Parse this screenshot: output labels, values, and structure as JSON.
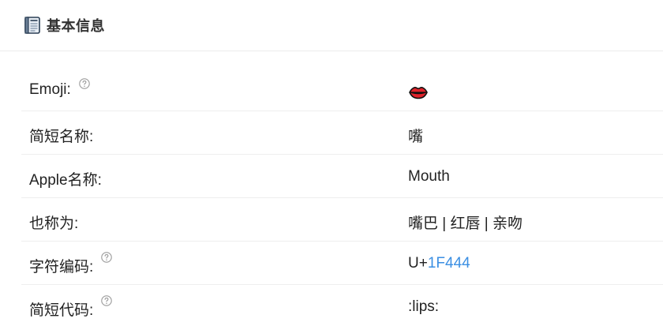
{
  "header": {
    "icon": "newspaper-icon",
    "title": "基本信息"
  },
  "rows": [
    {
      "label": "Emoji:",
      "has_help": true,
      "value_type": "emoji",
      "value_icon": "lips-emoji"
    },
    {
      "label": "简短名称:",
      "has_help": false,
      "value": "嘴"
    },
    {
      "label": "Apple名称:",
      "has_help": false,
      "value": "Mouth"
    },
    {
      "label": "也称为:",
      "has_help": false,
      "value": "嘴巴 | 红唇 | 亲吻"
    },
    {
      "label": "字符编码:",
      "has_help": true,
      "value_prefix": "U+",
      "value_link": "1F444"
    },
    {
      "label": "简短代码:",
      "has_help": true,
      "value": ":lips:"
    }
  ],
  "colors": {
    "link": "#3b8fe3",
    "divider": "#eeeeee",
    "help_icon": "#9a9a9a"
  }
}
